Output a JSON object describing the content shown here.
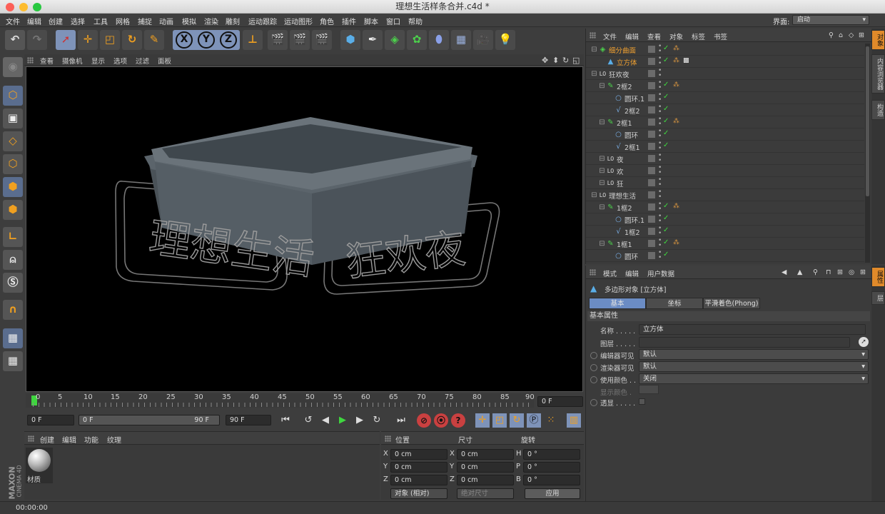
{
  "window": {
    "title": "理想生活样条合并.c4d *"
  },
  "menubar": {
    "items": [
      "文件",
      "编辑",
      "创建",
      "选择",
      "工具",
      "网格",
      "捕捉",
      "动画",
      "模拟",
      "渲染",
      "雕刻",
      "运动跟踪",
      "运动图形",
      "角色",
      "插件",
      "脚本",
      "窗口",
      "帮助"
    ],
    "layout_label": "界面:",
    "layout_value": "启动"
  },
  "viewport": {
    "menu": [
      "查看",
      "摄像机",
      "显示",
      "选项",
      "过滤",
      "面板"
    ],
    "scene_text_left": "理想生活",
    "scene_text_right": "狂欢夜"
  },
  "timeline": {
    "ticks": [
      "0",
      "5",
      "10",
      "15",
      "20",
      "25",
      "30",
      "35",
      "40",
      "45",
      "50",
      "55",
      "60",
      "65",
      "70",
      "75",
      "80",
      "85",
      "90"
    ],
    "current_frame": "0 F",
    "start_field": "0 F",
    "range_left": "0 F",
    "range_right": "90 F",
    "end_field": "90 F"
  },
  "material_manager": {
    "menu": [
      "创建",
      "编辑",
      "功能",
      "纹理"
    ],
    "material_label": "材质",
    "logo_top": "MAXON",
    "logo_bottom": "CINEMA 4D"
  },
  "coordinates": {
    "headers": [
      "位置",
      "尺寸",
      "旋转"
    ],
    "rows": [
      {
        "axis": "X",
        "pos": "0 cm",
        "sizeaxis": "X",
        "size": "0 cm",
        "rotaxis": "H",
        "rot": "0 °"
      },
      {
        "axis": "Y",
        "pos": "0 cm",
        "sizeaxis": "Y",
        "size": "0 cm",
        "rotaxis": "P",
        "rot": "0 °"
      },
      {
        "axis": "Z",
        "pos": "0 cm",
        "sizeaxis": "Z",
        "size": "0 cm",
        "rotaxis": "B",
        "rot": "0 °"
      }
    ],
    "mode_select": "对象 (相对)",
    "size_select": "绝对尺寸",
    "apply_label": "应用"
  },
  "status": {
    "time": "00:00:00"
  },
  "object_manager": {
    "menu": [
      "文件",
      "编辑",
      "查看",
      "对象",
      "标签",
      "书签"
    ],
    "objects": [
      {
        "name": "细分曲面",
        "indent": 0,
        "icon": "subdivision",
        "selected": true,
        "tags": 1
      },
      {
        "name": "立方体",
        "indent": 1,
        "icon": "cube",
        "selected": true,
        "tags": 2
      },
      {
        "name": "狂欢夜",
        "indent": 0,
        "icon": "null",
        "selected": false,
        "tags": 0
      },
      {
        "name": "2框2",
        "indent": 1,
        "icon": "sweep",
        "selected": false,
        "tags": 1
      },
      {
        "name": "圆环.1",
        "indent": 2,
        "icon": "circle",
        "selected": false,
        "tags": 0
      },
      {
        "name": "2框2",
        "indent": 2,
        "icon": "spline",
        "selected": false,
        "tags": 0
      },
      {
        "name": "2框1",
        "indent": 1,
        "icon": "sweep",
        "selected": false,
        "tags": 1
      },
      {
        "name": "圆环",
        "indent": 2,
        "icon": "circle",
        "selected": false,
        "tags": 0
      },
      {
        "name": "2框1",
        "indent": 2,
        "icon": "spline",
        "selected": false,
        "tags": 0
      },
      {
        "name": "夜",
        "indent": 1,
        "icon": "null",
        "selected": false,
        "tags": 0
      },
      {
        "name": "欢",
        "indent": 1,
        "icon": "null",
        "selected": false,
        "tags": 0
      },
      {
        "name": "狂",
        "indent": 1,
        "icon": "null",
        "selected": false,
        "tags": 0
      },
      {
        "name": "理想生活",
        "indent": 0,
        "icon": "null",
        "selected": false,
        "tags": 0
      },
      {
        "name": "1框2",
        "indent": 1,
        "icon": "sweep",
        "selected": false,
        "tags": 1
      },
      {
        "name": "圆环.1",
        "indent": 2,
        "icon": "circle",
        "selected": false,
        "tags": 0
      },
      {
        "name": "1框2",
        "indent": 2,
        "icon": "spline",
        "selected": false,
        "tags": 0
      },
      {
        "name": "1框1",
        "indent": 1,
        "icon": "sweep",
        "selected": false,
        "tags": 1
      },
      {
        "name": "圆环",
        "indent": 2,
        "icon": "circle",
        "selected": false,
        "tags": 0
      }
    ]
  },
  "side_tabs_top": [
    "对象",
    "内容浏览器",
    "构造"
  ],
  "side_tabs_bottom": [
    "属性",
    "层"
  ],
  "attributes": {
    "menu": [
      "模式",
      "编辑",
      "用户数据"
    ],
    "object_title": "多边形对象 [立方体]",
    "tabs": [
      "基本",
      "坐标",
      "平滑着色(Phong)"
    ],
    "section": "基本属性",
    "rows": [
      {
        "label": "名称 . . . . .",
        "value": "立方体"
      },
      {
        "label": "图层 . . . . .",
        "value": ""
      },
      {
        "label": "编辑器可见",
        "value": "默认"
      },
      {
        "label": "渲染器可见",
        "value": "默认"
      },
      {
        "label": "使用颜色 . .",
        "value": "关闭"
      },
      {
        "label": "显示颜色 .",
        "value": ""
      },
      {
        "label": "透显 . . . . .",
        "value": ""
      }
    ]
  },
  "colors": {
    "accent": "#e08a2a",
    "selected_text": "#f0a030",
    "tab_active": "#6b8cc4",
    "check": "#3fd63f",
    "brand": "#7e93b9"
  }
}
